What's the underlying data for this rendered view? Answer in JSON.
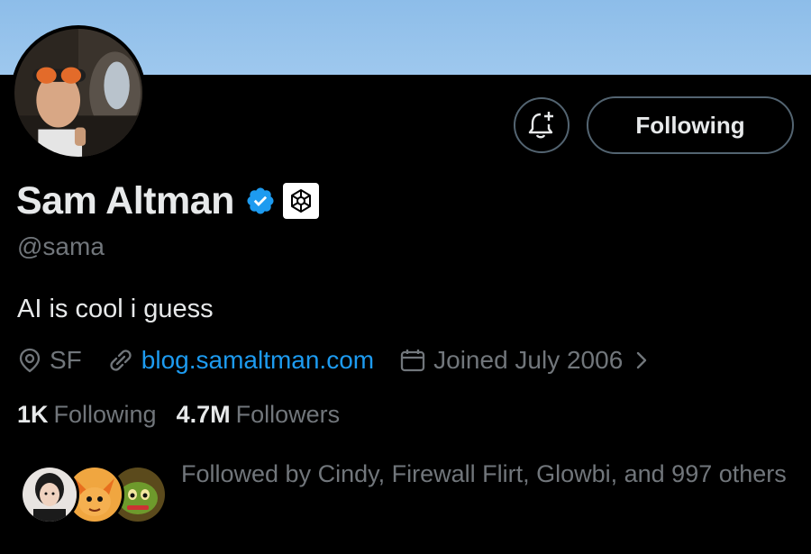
{
  "profile": {
    "display_name": "Sam Altman",
    "handle": "@sama",
    "bio": "AI is cool i guess",
    "location": "SF",
    "website": "blog.samaltman.com",
    "joined": "Joined July 2006",
    "verified_icon": "verified-badge-icon",
    "affiliation_icon": "openai-logo-icon"
  },
  "actions": {
    "notify_icon": "bell-plus-icon",
    "following_label": "Following"
  },
  "stats": {
    "following_count": "1K",
    "following_label": "Following",
    "followers_count": "4.7M",
    "followers_label": "Followers"
  },
  "followed_by": {
    "text": "Followed by Cindy, Firewall Flirt, Glowbi, and 997 others"
  },
  "colors": {
    "banner": "#9ec8ee",
    "background": "#000000",
    "text_primary": "#e7e9ea",
    "text_secondary": "#71767b",
    "link": "#1d9bf0",
    "verified": "#1d9bf0",
    "button_border": "#536471"
  }
}
